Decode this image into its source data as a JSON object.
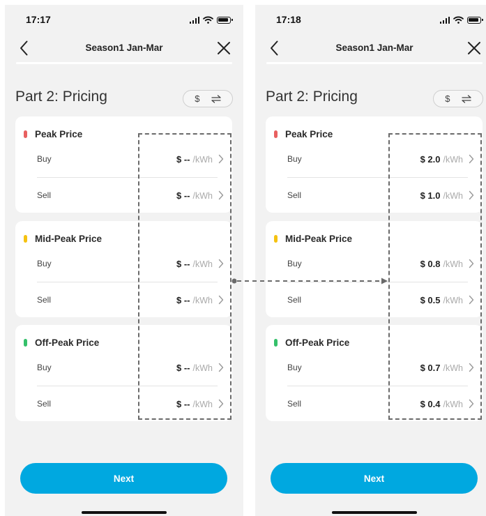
{
  "screens": [
    {
      "status": {
        "time": "17:17"
      },
      "nav": {
        "title": "Season1 Jan-Mar"
      },
      "section_title": "Part 2: Pricing",
      "unit_toggle": {
        "label": "$"
      },
      "cards": [
        {
          "title": "Peak Price",
          "color": "#e86060",
          "rows": [
            {
              "label": "Buy",
              "value": "$ --",
              "unit": "/kWh"
            },
            {
              "label": "Sell",
              "value": "$ --",
              "unit": "/kWh"
            }
          ]
        },
        {
          "title": "Mid-Peak Price",
          "color": "#f5c211",
          "rows": [
            {
              "label": "Buy",
              "value": "$ --",
              "unit": "/kWh"
            },
            {
              "label": "Sell",
              "value": "$ --",
              "unit": "/kWh"
            }
          ]
        },
        {
          "title": "Off-Peak Price",
          "color": "#34c06a",
          "rows": [
            {
              "label": "Buy",
              "value": "$ --",
              "unit": "/kWh"
            },
            {
              "label": "Sell",
              "value": "$ --",
              "unit": "/kWh"
            }
          ]
        }
      ],
      "next_label": "Next"
    },
    {
      "status": {
        "time": "17:18"
      },
      "nav": {
        "title": "Season1 Jan-Mar"
      },
      "section_title": "Part 2: Pricing",
      "unit_toggle": {
        "label": "$"
      },
      "cards": [
        {
          "title": "Peak Price",
          "color": "#e86060",
          "rows": [
            {
              "label": "Buy",
              "value": "$ 2.0",
              "unit": "/kWh"
            },
            {
              "label": "Sell",
              "value": "$ 1.0",
              "unit": "/kWh"
            }
          ]
        },
        {
          "title": "Mid-Peak Price",
          "color": "#f5c211",
          "rows": [
            {
              "label": "Buy",
              "value": "$ 0.8",
              "unit": "/kWh"
            },
            {
              "label": "Sell",
              "value": "$ 0.5",
              "unit": "/kWh"
            }
          ]
        },
        {
          "title": "Off-Peak Price",
          "color": "#34c06a",
          "rows": [
            {
              "label": "Buy",
              "value": "$ 0.7",
              "unit": "/kWh"
            },
            {
              "label": "Sell",
              "value": "$ 0.4",
              "unit": "/kWh"
            }
          ]
        }
      ],
      "next_label": "Next"
    }
  ],
  "theme": {
    "accent": "#00a8e0",
    "screen_background": "#f2f2f2",
    "card_background": "#ffffff",
    "annotation_color": "#6a6a6a"
  },
  "icons": [
    "signal-icon",
    "wifi-icon",
    "battery-icon",
    "back-icon",
    "close-icon",
    "swap-icon",
    "chevron-right-icon",
    "home-indicator"
  ]
}
